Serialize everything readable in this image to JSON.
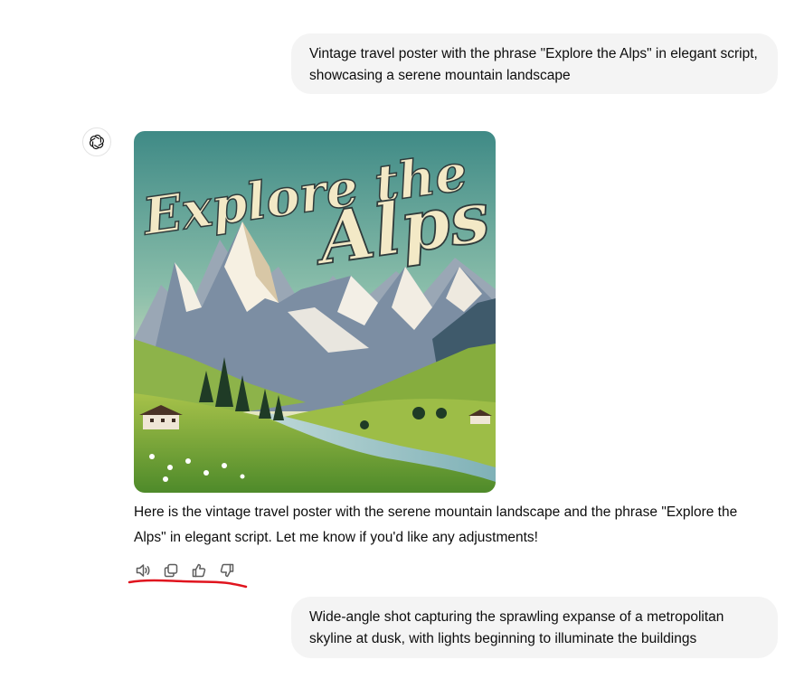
{
  "conversation": {
    "messages": [
      {
        "role": "user",
        "text": "Vintage travel poster with the phrase \"Explore the Alps\" in elegant script, showcasing a serene mountain landscape"
      },
      {
        "role": "assistant",
        "image": {
          "icon": "generated-image",
          "overlay_text_line1": "Explore the",
          "overlay_text_line2": "Alps"
        },
        "text": "Here is the vintage travel poster with the serene mountain landscape and the phrase \"Explore the Alps\" in elegant script. Let me know if you'd like any adjustments!",
        "actions": [
          {
            "icon": "speaker-icon"
          },
          {
            "icon": "copy-icon"
          },
          {
            "icon": "thumbs-up-icon"
          },
          {
            "icon": "thumbs-down-icon"
          }
        ]
      },
      {
        "role": "user",
        "text": "Wide-angle shot capturing the sprawling expanse of a metropolitan skyline at dusk, with lights beginning to illuminate the buildings"
      }
    ]
  },
  "annotation": {
    "color": "#e0141e"
  },
  "colors": {
    "user_bubble_bg": "#f4f4f4",
    "text": "#0d0d0d",
    "icon": "#5d5d5d"
  }
}
